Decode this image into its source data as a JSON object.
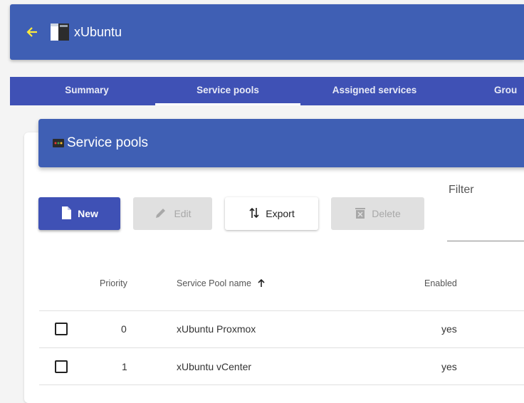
{
  "header": {
    "title": "xUbuntu",
    "back_icon": "arrow-left-icon",
    "app_icon": "app-window-icon"
  },
  "tabs": [
    {
      "label": "Summary",
      "active": false
    },
    {
      "label": "Service pools",
      "active": true
    },
    {
      "label": "Assigned services",
      "active": false
    },
    {
      "label": "Grou",
      "active": false
    }
  ],
  "card": {
    "title": "Service pools",
    "icon": "service-pools-icon"
  },
  "toolbar": {
    "new_label": "New",
    "edit_label": "Edit",
    "export_label": "Export",
    "delete_label": "Delete"
  },
  "filter": {
    "label": "Filter",
    "value": ""
  },
  "table": {
    "columns": [
      "Priority",
      "Service Pool name",
      "Enabled"
    ],
    "sort_column": "Service Pool name",
    "rows": [
      {
        "priority": "0",
        "name": "xUbuntu Proxmox",
        "enabled": "yes"
      },
      {
        "priority": "1",
        "name": "xUbuntu vCenter",
        "enabled": "yes"
      }
    ]
  },
  "colors": {
    "primary": "#3f51b5",
    "header": "#3f5fb4",
    "accent": "#ffeb3b"
  }
}
